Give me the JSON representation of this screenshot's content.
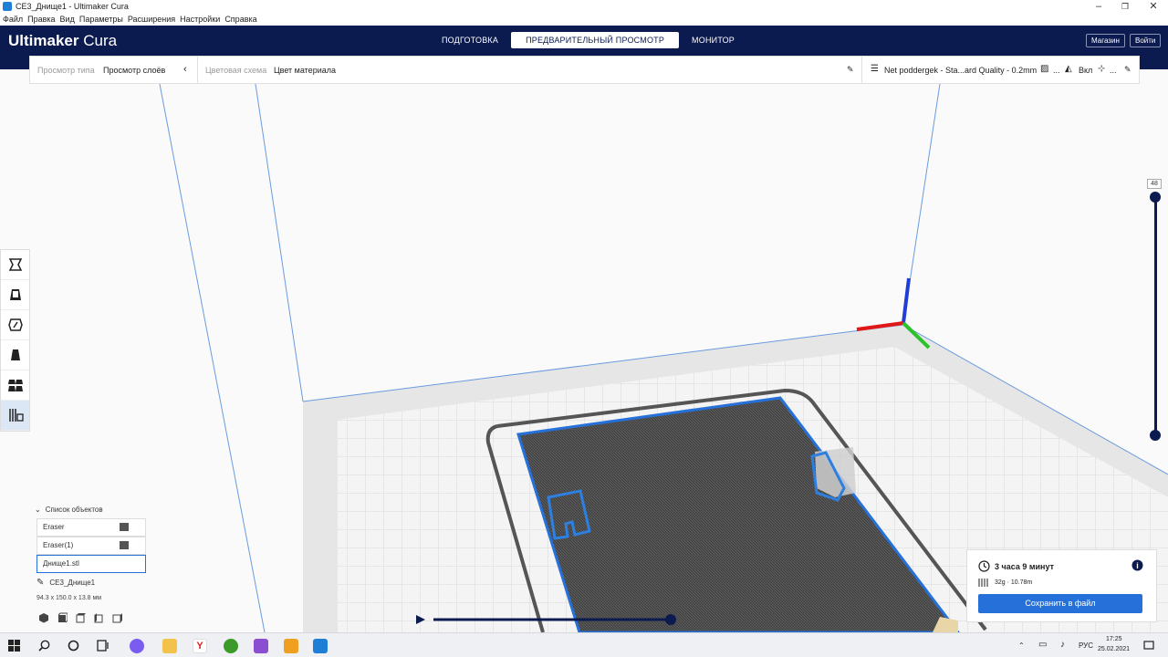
{
  "window": {
    "title": "CE3_Днище1 - Ultimaker Cura",
    "menu": [
      "Файл",
      "Правка",
      "Вид",
      "Параметры",
      "Расширения",
      "Настройки",
      "Справка"
    ],
    "controls": {
      "minimize": "–",
      "maximize": "❐",
      "close": "✕"
    }
  },
  "header": {
    "logo_brand": "Ultimaker",
    "logo_product": "Cura",
    "tabs": [
      {
        "label": "ПОДГОТОВКА",
        "active": false
      },
      {
        "label": "ПРЕДВАРИТЕЛЬНЫЙ ПРОСМОТР",
        "active": true
      },
      {
        "label": "МОНИТОР",
        "active": false
      }
    ],
    "marketplace_label": "Магазин",
    "signin_label": "Войти",
    "background_color": "#0b1a4f"
  },
  "topbar": {
    "view_type_label": "Просмотр типа",
    "view_type_value": "Просмотр слоёв",
    "color_scheme_label": "Цветовая схема",
    "color_scheme_value": "Цвет материала",
    "profile": "Net poddergek - Sta...ard Quality - 0.2mm",
    "infill_value": "...",
    "support_value": "Вкл",
    "adhesion_value": "..."
  },
  "tools": [
    {
      "name": "move-tool",
      "active": false
    },
    {
      "name": "scale-tool",
      "active": false
    },
    {
      "name": "rotate-tool",
      "active": false
    },
    {
      "name": "mirror-tool",
      "active": false
    },
    {
      "name": "per-model-settings-tool",
      "active": false
    },
    {
      "name": "support-blocker-tool",
      "active": true
    }
  ],
  "object_list": {
    "header": "Список объектов",
    "items": [
      {
        "label": "Eraser",
        "selected": false
      },
      {
        "label": "Eraser(1)",
        "selected": false
      },
      {
        "label": "Днище1.stl",
        "selected": true
      }
    ],
    "job_name": "CE3_Днище1",
    "dimensions": "94.3 x 150.0 x 13.8 мм"
  },
  "layer_slider": {
    "current_layer": "48"
  },
  "print_info": {
    "time": "3 часа 9 минут",
    "material": "32g · 10.78m",
    "save_label": "Сохранить в файл"
  },
  "taskbar": {
    "language": "РУС",
    "time": "17:25",
    "date": "25.02.2021"
  },
  "colors": {
    "accent": "#2671d9",
    "header": "#0b1a4f"
  }
}
